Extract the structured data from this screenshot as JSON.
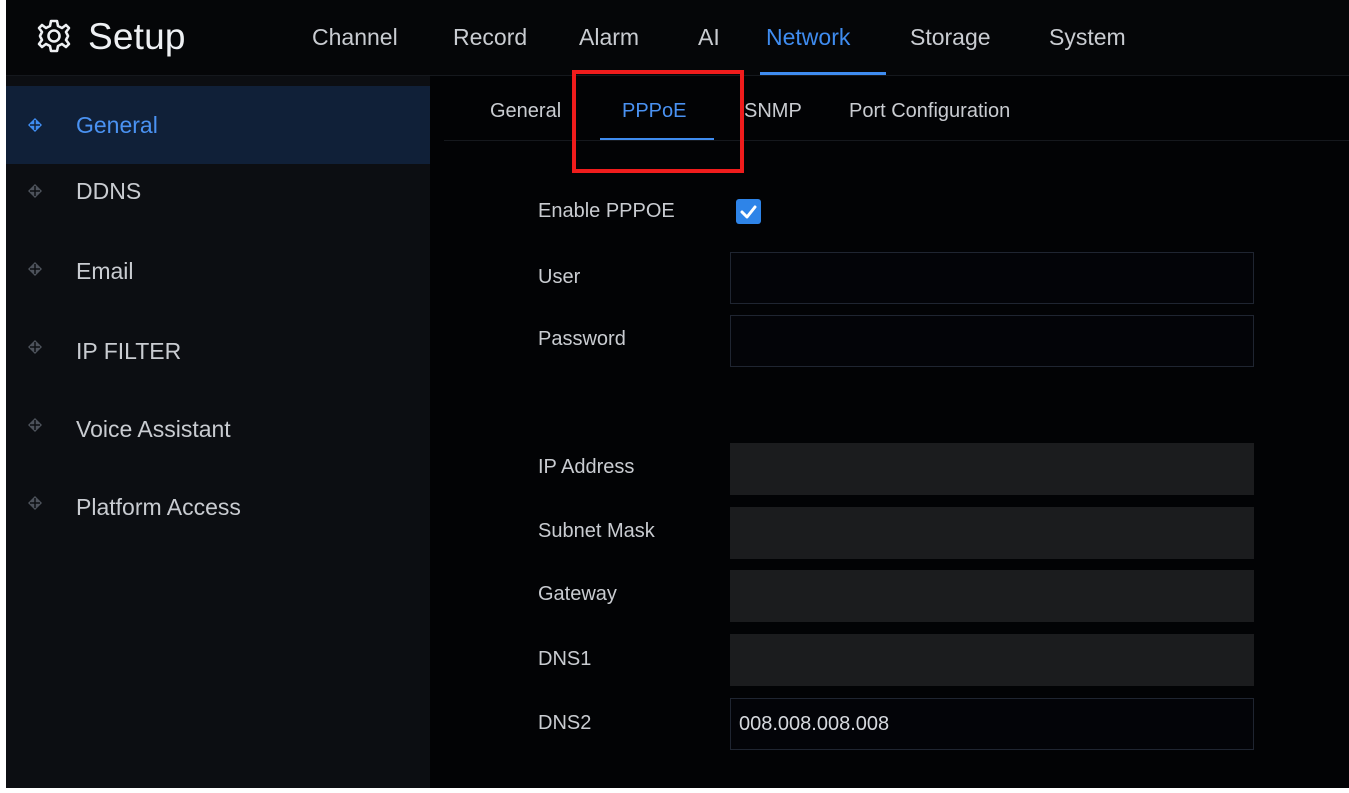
{
  "header": {
    "app_title": "Setup",
    "tabs": [
      "Channel",
      "Record",
      "Alarm",
      "AI",
      "Network",
      "Storage",
      "System"
    ],
    "active_tab": "Network"
  },
  "sidebar": {
    "items": [
      {
        "label": "General",
        "active": true
      },
      {
        "label": "DDNS",
        "active": false
      },
      {
        "label": "Email",
        "active": false
      },
      {
        "label": "IP FILTER",
        "active": false
      },
      {
        "label": "Voice Assistant",
        "active": false
      },
      {
        "label": "Platform Access",
        "active": false
      }
    ]
  },
  "subtabs": {
    "items": [
      "General",
      "PPPoE",
      "SNMP",
      "Port Configuration"
    ],
    "active": "PPPoE"
  },
  "form": {
    "enable_label": "Enable PPPOE",
    "enable_checked": true,
    "user_label": "User",
    "user_value": "",
    "password_label": "Password",
    "password_value": "",
    "ip_label": "IP Address",
    "ip_value": "",
    "subnet_label": "Subnet Mask",
    "subnet_value": "",
    "gateway_label": "Gateway",
    "gateway_value": "",
    "dns1_label": "DNS1",
    "dns1_value": "",
    "dns2_label": "DNS2",
    "dns2_value": "008.008.008.008"
  },
  "colors": {
    "accent": "#3f8cf0",
    "annotation": "#ef1c1c",
    "background": "#010203"
  }
}
